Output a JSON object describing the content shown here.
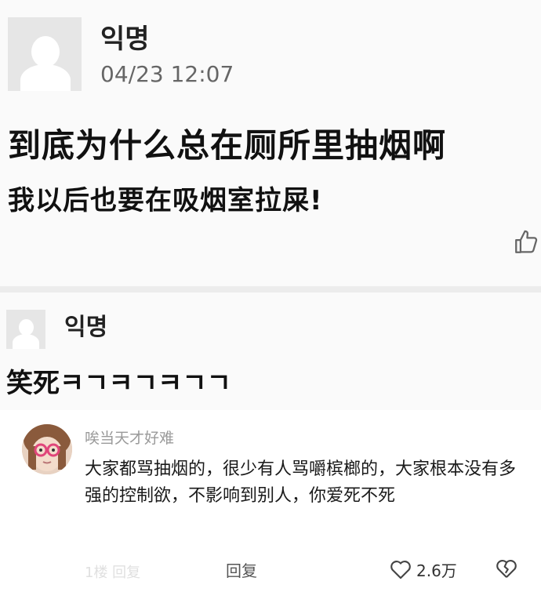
{
  "post": {
    "author": "익명",
    "time": "04/23 12:07",
    "line1": "到底为什么总在厕所里抽烟啊",
    "line2": "我以后也要在吸烟室拉屎!"
  },
  "reply": {
    "author": "익명",
    "text": "笑死ㅋㄱㅋㄱㅋㄱㄱ"
  },
  "comment": {
    "username": "唉当天才好难",
    "text": "大家都骂抽烟的，很少有人骂嚼槟榔的，大家根本没有多强的控制欲，不影响到别人，你爱死不死",
    "reply_label": "回复",
    "likes": "2.6万",
    "faded_text": "1楼 回复"
  },
  "icons": {
    "like": "thumbs-up-outline-icon",
    "heart": "heart-outline-icon",
    "dislike": "broken-heart-outline-icon"
  }
}
